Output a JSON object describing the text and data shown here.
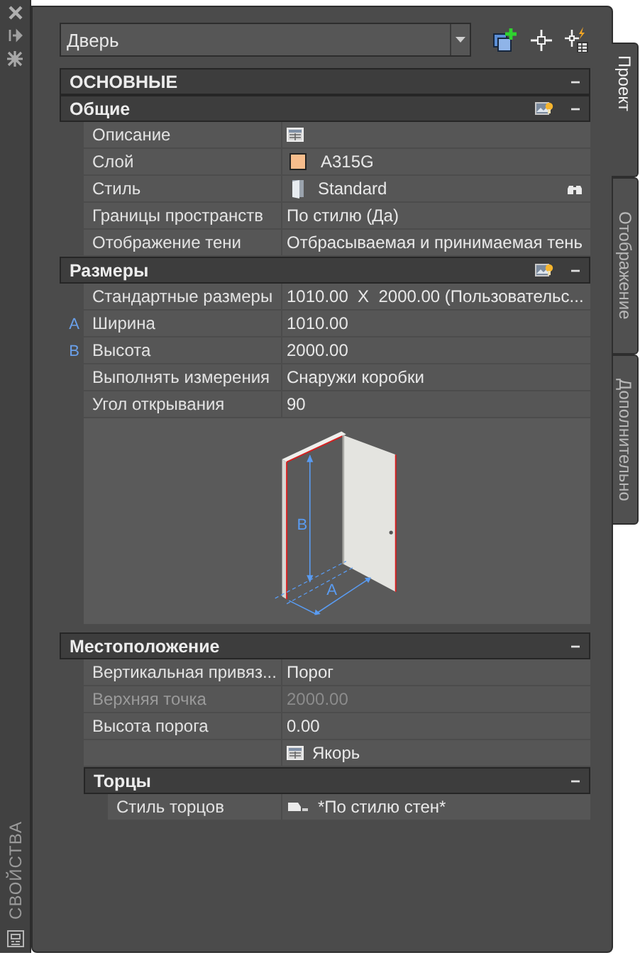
{
  "palette_title": "СВОЙСТВА",
  "object_selector": {
    "value": "Дверь"
  },
  "side_tabs": [
    {
      "label": "Проект",
      "selected": true
    },
    {
      "label": "Отображение",
      "selected": false
    },
    {
      "label": "Дополнительно",
      "selected": false
    }
  ],
  "category": {
    "title": "ОСНОВНЫЕ",
    "collapse": "−"
  },
  "sections": [
    {
      "title": "Общие",
      "collapse": "−",
      "expanded": true,
      "quick_properties": true,
      "rows": [
        {
          "label": "Описание",
          "kind": "table",
          "value": "",
          "disabled": false
        },
        {
          "label": "Слой",
          "kind": "swatch",
          "color": "#f7bd8c",
          "value": "A315G",
          "disabled": false
        },
        {
          "label": "Стиль",
          "kind": "style",
          "value": "Standard",
          "disabled": false
        },
        {
          "label": "Границы пространств",
          "kind": "text",
          "value": "По стилю (Да)",
          "disabled": false
        },
        {
          "label": "Отображение тени",
          "kind": "text",
          "value": "Отбрасываемая и принимаемая тень",
          "disabled": false
        }
      ]
    },
    {
      "title": "Размеры",
      "collapse": "−",
      "expanded": true,
      "quick_properties": true,
      "rows": [
        {
          "label": "Стандартные размеры",
          "kind": "text",
          "value": "1010.00  X  2000.00 (Пользовательс...",
          "disabled": false
        },
        {
          "label": "Ширина",
          "marker": "A",
          "kind": "text",
          "value": "1010.00",
          "disabled": false
        },
        {
          "label": "Высота",
          "marker": "B",
          "kind": "text",
          "value": "2000.00",
          "disabled": false
        },
        {
          "label": "Выполнять измерения",
          "kind": "text",
          "value": "Снаружи коробки",
          "disabled": false
        },
        {
          "label": "Угол открывания",
          "kind": "text",
          "value": "90",
          "disabled": false
        }
      ],
      "illustration": {
        "width_label": "A",
        "height_label": "B"
      }
    },
    {
      "title": "Местоположение",
      "collapse": "−",
      "expanded": true,
      "quick_properties": false,
      "rows": [
        {
          "label": "Вертикальная  привяз...",
          "kind": "text",
          "value": "Порог",
          "disabled": false
        },
        {
          "label": "Верхняя точка",
          "kind": "text",
          "value": "2000.00",
          "disabled": true
        },
        {
          "label": "Высота порога",
          "kind": "text",
          "value": "0.00",
          "disabled": false
        },
        {
          "label": "",
          "kind": "table",
          "value": "Якорь",
          "disabled": false
        }
      ],
      "children": [
        {
          "title": "Торцы",
          "collapse": "−",
          "expanded": true,
          "quick_properties": false,
          "rows": [
            {
              "label": "Стиль торцов",
              "kind": "endcap",
              "value": "*По стилю стен*",
              "disabled": false
            }
          ]
        }
      ]
    }
  ]
}
